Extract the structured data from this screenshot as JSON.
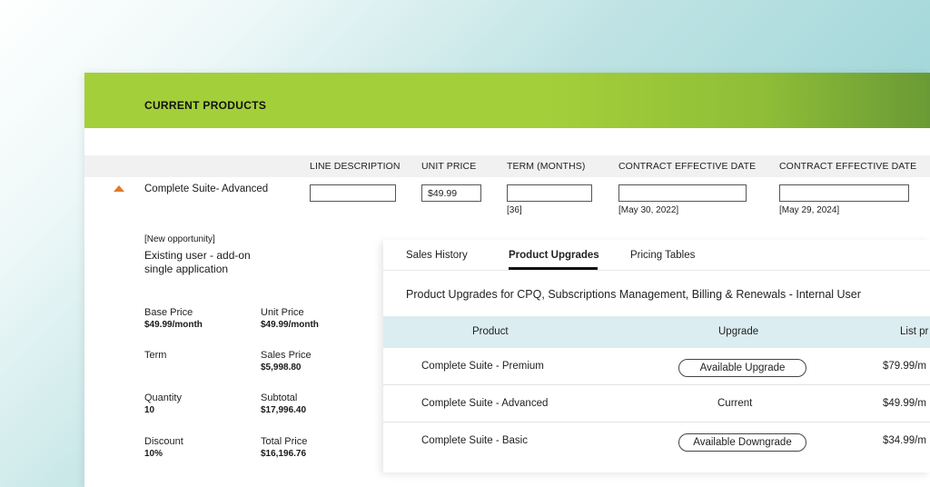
{
  "header": {
    "title": "CURRENT PRODUCTS"
  },
  "columns": {
    "line_description": "LINE DESCRIPTION",
    "unit_price": "UNIT PRICE",
    "term": "TERM (MONTHS)",
    "effective_date_1": "CONTRACT EFFECTIVE DATE",
    "effective_date_2": "CONTRACT EFFECTIVE DATE"
  },
  "line": {
    "name": "Complete Suite- Advanced",
    "line_description_value": "",
    "unit_price_value": "$49.99",
    "term_value": "",
    "term_sub": "[36]",
    "effective_date_1_value": "",
    "effective_date_1_sub": "[May 30, 2022]",
    "effective_date_2_value": "",
    "effective_date_2_sub": "[May 29, 2024]"
  },
  "opportunity": {
    "tag": "[New opportunity]",
    "description": "Existing user - add-on single application"
  },
  "summary": {
    "base_price_label": "Base Price",
    "base_price": "$49.99/month",
    "unit_price_label": "Unit Price",
    "unit_price": "$49.99/month",
    "term_label": "Term",
    "term": "",
    "sales_price_label": "Sales Price",
    "sales_price": "$5,998.80",
    "quantity_label": "Quantity",
    "quantity": "10",
    "subtotal_label": "Subtotal",
    "subtotal": "$17,996.40",
    "discount_label": "Discount",
    "discount": "10%",
    "total_price_label": "Total Price",
    "total_price": "$16,196.76"
  },
  "tabs": [
    {
      "label": "Sales History"
    },
    {
      "label": "Product Upgrades"
    },
    {
      "label": "Pricing Tables"
    }
  ],
  "upgrades": {
    "title": "Product  Upgrades for CPQ, Subscriptions Management, Billing & Renewals - Internal User",
    "headers": {
      "product": "Product",
      "upgrade": "Upgrade",
      "list_price": "List pr"
    },
    "rows": [
      {
        "product": "Complete Suite - Premium",
        "upgrade": "Available Upgrade",
        "list_price": "$79.99/m"
      },
      {
        "product": "Complete Suite - Advanced",
        "upgrade": "Current",
        "list_price": "$49.99/m"
      },
      {
        "product": "Complete Suite - Basic",
        "upgrade": "Available Downgrade",
        "list_price": "$34.99/m"
      }
    ]
  },
  "colors": {
    "header_green": "#a3cf3a",
    "arrow_orange": "#e07a2b",
    "table_header_blue": "#dcedf2"
  }
}
